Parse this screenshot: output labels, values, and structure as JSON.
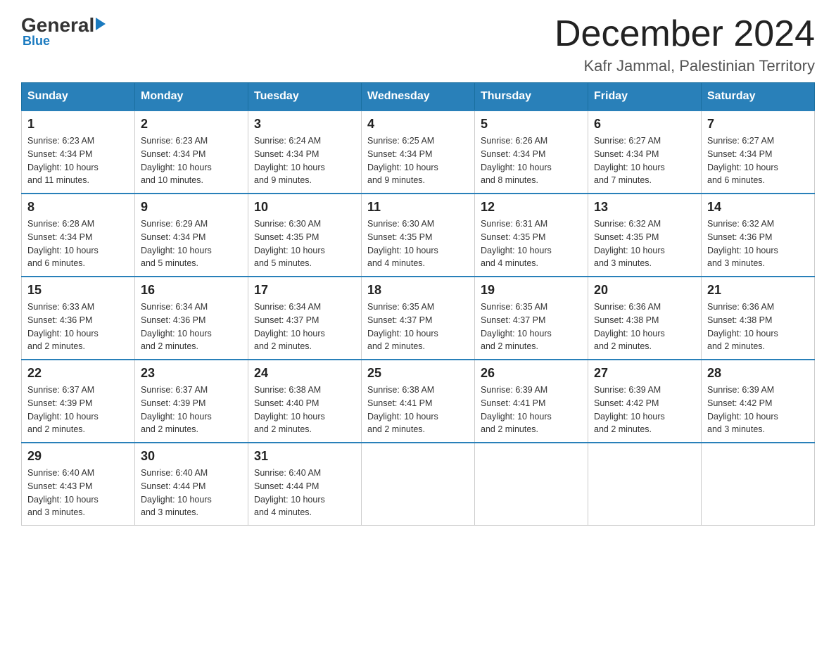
{
  "header": {
    "logo": {
      "general": "General",
      "blue": "Blue",
      "subtitle": "Blue"
    },
    "title": "December 2024",
    "location": "Kafr Jammal, Palestinian Territory"
  },
  "days_of_week": [
    "Sunday",
    "Monday",
    "Tuesday",
    "Wednesday",
    "Thursday",
    "Friday",
    "Saturday"
  ],
  "weeks": [
    [
      {
        "day": "1",
        "sunrise": "6:23 AM",
        "sunset": "4:34 PM",
        "daylight": "10 hours and 11 minutes."
      },
      {
        "day": "2",
        "sunrise": "6:23 AM",
        "sunset": "4:34 PM",
        "daylight": "10 hours and 10 minutes."
      },
      {
        "day": "3",
        "sunrise": "6:24 AM",
        "sunset": "4:34 PM",
        "daylight": "10 hours and 9 minutes."
      },
      {
        "day": "4",
        "sunrise": "6:25 AM",
        "sunset": "4:34 PM",
        "daylight": "10 hours and 9 minutes."
      },
      {
        "day": "5",
        "sunrise": "6:26 AM",
        "sunset": "4:34 PM",
        "daylight": "10 hours and 8 minutes."
      },
      {
        "day": "6",
        "sunrise": "6:27 AM",
        "sunset": "4:34 PM",
        "daylight": "10 hours and 7 minutes."
      },
      {
        "day": "7",
        "sunrise": "6:27 AM",
        "sunset": "4:34 PM",
        "daylight": "10 hours and 6 minutes."
      }
    ],
    [
      {
        "day": "8",
        "sunrise": "6:28 AM",
        "sunset": "4:34 PM",
        "daylight": "10 hours and 6 minutes."
      },
      {
        "day": "9",
        "sunrise": "6:29 AM",
        "sunset": "4:34 PM",
        "daylight": "10 hours and 5 minutes."
      },
      {
        "day": "10",
        "sunrise": "6:30 AM",
        "sunset": "4:35 PM",
        "daylight": "10 hours and 5 minutes."
      },
      {
        "day": "11",
        "sunrise": "6:30 AM",
        "sunset": "4:35 PM",
        "daylight": "10 hours and 4 minutes."
      },
      {
        "day": "12",
        "sunrise": "6:31 AM",
        "sunset": "4:35 PM",
        "daylight": "10 hours and 4 minutes."
      },
      {
        "day": "13",
        "sunrise": "6:32 AM",
        "sunset": "4:35 PM",
        "daylight": "10 hours and 3 minutes."
      },
      {
        "day": "14",
        "sunrise": "6:32 AM",
        "sunset": "4:36 PM",
        "daylight": "10 hours and 3 minutes."
      }
    ],
    [
      {
        "day": "15",
        "sunrise": "6:33 AM",
        "sunset": "4:36 PM",
        "daylight": "10 hours and 2 minutes."
      },
      {
        "day": "16",
        "sunrise": "6:34 AM",
        "sunset": "4:36 PM",
        "daylight": "10 hours and 2 minutes."
      },
      {
        "day": "17",
        "sunrise": "6:34 AM",
        "sunset": "4:37 PM",
        "daylight": "10 hours and 2 minutes."
      },
      {
        "day": "18",
        "sunrise": "6:35 AM",
        "sunset": "4:37 PM",
        "daylight": "10 hours and 2 minutes."
      },
      {
        "day": "19",
        "sunrise": "6:35 AM",
        "sunset": "4:37 PM",
        "daylight": "10 hours and 2 minutes."
      },
      {
        "day": "20",
        "sunrise": "6:36 AM",
        "sunset": "4:38 PM",
        "daylight": "10 hours and 2 minutes."
      },
      {
        "day": "21",
        "sunrise": "6:36 AM",
        "sunset": "4:38 PM",
        "daylight": "10 hours and 2 minutes."
      }
    ],
    [
      {
        "day": "22",
        "sunrise": "6:37 AM",
        "sunset": "4:39 PM",
        "daylight": "10 hours and 2 minutes."
      },
      {
        "day": "23",
        "sunrise": "6:37 AM",
        "sunset": "4:39 PM",
        "daylight": "10 hours and 2 minutes."
      },
      {
        "day": "24",
        "sunrise": "6:38 AM",
        "sunset": "4:40 PM",
        "daylight": "10 hours and 2 minutes."
      },
      {
        "day": "25",
        "sunrise": "6:38 AM",
        "sunset": "4:41 PM",
        "daylight": "10 hours and 2 minutes."
      },
      {
        "day": "26",
        "sunrise": "6:39 AM",
        "sunset": "4:41 PM",
        "daylight": "10 hours and 2 minutes."
      },
      {
        "day": "27",
        "sunrise": "6:39 AM",
        "sunset": "4:42 PM",
        "daylight": "10 hours and 2 minutes."
      },
      {
        "day": "28",
        "sunrise": "6:39 AM",
        "sunset": "4:42 PM",
        "daylight": "10 hours and 3 minutes."
      }
    ],
    [
      {
        "day": "29",
        "sunrise": "6:40 AM",
        "sunset": "4:43 PM",
        "daylight": "10 hours and 3 minutes."
      },
      {
        "day": "30",
        "sunrise": "6:40 AM",
        "sunset": "4:44 PM",
        "daylight": "10 hours and 3 minutes."
      },
      {
        "day": "31",
        "sunrise": "6:40 AM",
        "sunset": "4:44 PM",
        "daylight": "10 hours and 4 minutes."
      },
      null,
      null,
      null,
      null
    ]
  ],
  "labels": {
    "sunrise": "Sunrise:",
    "sunset": "Sunset:",
    "daylight": "Daylight:"
  }
}
